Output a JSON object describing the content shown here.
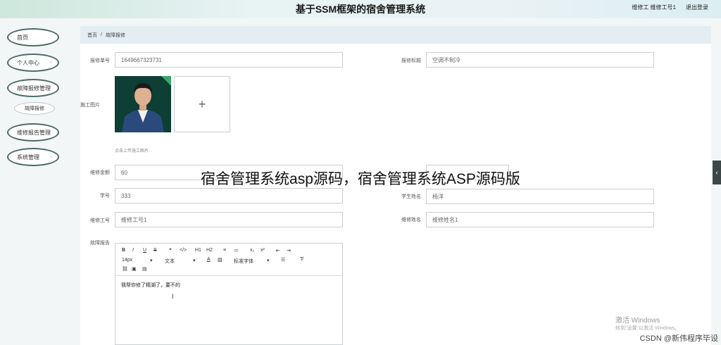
{
  "header": {
    "title": "基于SSM框架的宿舍管理系统",
    "user_label": "维修工 维修工号1",
    "logout": "退出登录"
  },
  "sidebar": {
    "items": [
      {
        "label": "首页",
        "chevron": ""
      },
      {
        "label": "个人中心",
        "chevron": "⌵"
      },
      {
        "label": "故障报修管理",
        "chevron": "⌵"
      },
      {
        "label": "故障报修",
        "chevron": ""
      },
      {
        "label": "维修报告管理",
        "chevron": "⌵"
      },
      {
        "label": "系统管理",
        "chevron": "⌵"
      }
    ]
  },
  "breadcrumb": {
    "home": "首页",
    "separator": "/",
    "current": "故障报修"
  },
  "form": {
    "repair_no_label": "报修单号",
    "repair_no_value": "1649667323731",
    "repair_title_label": "报修标题",
    "repair_title_value": "空调不制冷",
    "photo_label": "施工图片",
    "upload_symbol": "+",
    "upload_hint": "点击上传施工图片",
    "amount_label": "维修金额",
    "amount_value": "60",
    "student_no_label": "学号",
    "student_no_value": "333",
    "student_name_label": "学生姓名",
    "student_name_value": "杨洋",
    "worker_no_label": "维修工号",
    "worker_no_value": "维修工号1",
    "worker_name_label": "维修姓名",
    "worker_name_value": "维修姓名1",
    "report_label": "故障报告"
  },
  "editor": {
    "toolbar_row1": [
      "B",
      "I",
      "U",
      "S",
      "❞",
      "</>",
      "H1",
      "H2",
      "≡",
      "≔",
      "x₂",
      "x²",
      "⇤",
      "⇥"
    ],
    "font_size": "14px",
    "text_style": "文本",
    "font_family": "标准字体",
    "select_arrow": "▾",
    "body_text": "我帮你修了精湖了，要不的"
  },
  "overlay": {
    "caption": "宿舍管理系统asp源码，宿舍管理系统ASP源码版",
    "windows_activate": "激活 Windows",
    "windows_hint": "转到\"设置\"以激活 Windows。",
    "watermark": "CSDN @新伟程序毕设"
  },
  "side_tab": "‹"
}
